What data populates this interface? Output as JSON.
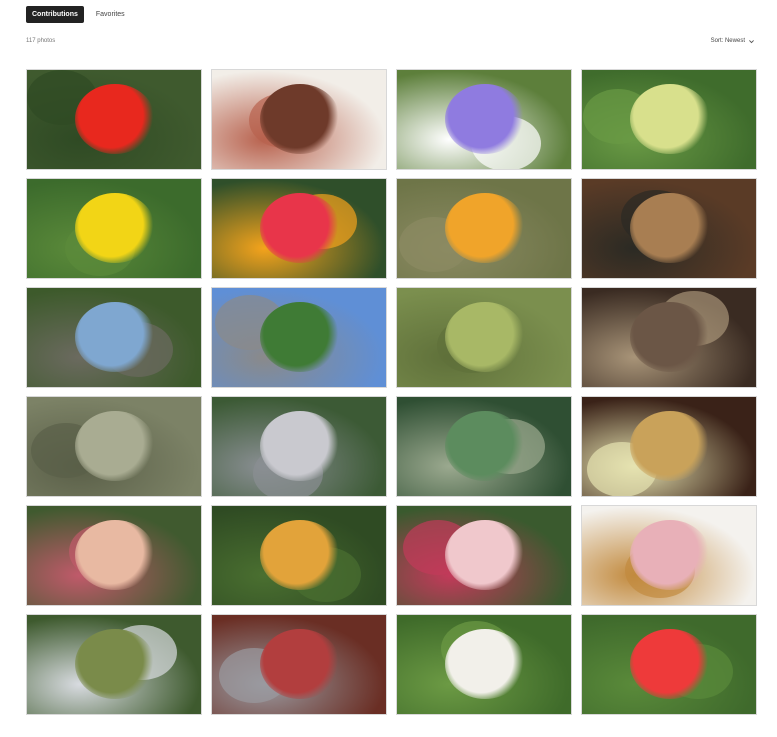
{
  "tabs": [
    {
      "label": "Contributions",
      "active": true
    },
    {
      "label": "Favorites",
      "active": false
    }
  ],
  "photo_count": "117 photos",
  "sort_label": "Sort: Newest",
  "photos": [
    {
      "icon": "red-geranium-photo",
      "bg": "#3f5a2e",
      "accent": "#e8281e",
      "accent2": "#2f4a24"
    },
    {
      "icon": "steak-plate-photo",
      "bg": "#f2eee8",
      "accent": "#6e3a2a",
      "accent2": "#b8624e"
    },
    {
      "icon": "purple-morning-glory-photo",
      "bg": "#5d7f3b",
      "accent": "#8f7be0",
      "accent2": "#ffffff"
    },
    {
      "icon": "green-fruit-leaves-photo",
      "bg": "#3f6c2c",
      "accent": "#d8e08c",
      "accent2": "#6a9a45"
    },
    {
      "icon": "yellow-daisy-photo",
      "bg": "#3c6b2c",
      "accent": "#f2d516",
      "accent2": "#5b8a3a"
    },
    {
      "icon": "lantana-flowers-photo",
      "bg": "#2f4f2a",
      "accent": "#e8354a",
      "accent2": "#f4a31c"
    },
    {
      "icon": "dry-orange-flower-photo",
      "bg": "#6e7548",
      "accent": "#f0a42a",
      "accent2": "#8b8a62"
    },
    {
      "icon": "wooden-pergola-photo",
      "bg": "#5a3b26",
      "accent": "#a87e52",
      "accent2": "#2b2a24"
    },
    {
      "icon": "overgrown-courtyard-photo",
      "bg": "#3d5a2b",
      "accent": "#7fa7d0",
      "accent2": "#6b6a5f"
    },
    {
      "icon": "gazebo-park-photo",
      "bg": "#5f8fd6",
      "accent": "#3f7b35",
      "accent2": "#8a8a8a"
    },
    {
      "icon": "green-bananas-photo",
      "bg": "#7b8f4e",
      "accent": "#a8b866",
      "accent2": "#5f703a"
    },
    {
      "icon": "wooden-bench-photo",
      "bg": "#3a2b22",
      "accent": "#6b5646",
      "accent2": "#a89478"
    },
    {
      "icon": "ornamental-grass-photo",
      "bg": "#7c8266",
      "accent": "#a9ac92",
      "accent2": "#5a5f48"
    },
    {
      "icon": "silver-rubber-leaves-photo",
      "bg": "#3c5a35",
      "accent": "#c9c9cf",
      "accent2": "#8a8f93"
    },
    {
      "icon": "agave-plant-photo",
      "bg": "#2f4f33",
      "accent": "#5c8c5e",
      "accent2": "#9ba98f"
    },
    {
      "icon": "chocolate-cake-photo",
      "bg": "#3a2218",
      "accent": "#c9a25a",
      "accent2": "#e6e3b0"
    },
    {
      "icon": "fig-fruit-photo",
      "bg": "#405a2f",
      "accent": "#e8b9a2",
      "accent2": "#c05a6a"
    },
    {
      "icon": "yellow-blossom-tree-photo",
      "bg": "#2f4b23",
      "accent": "#e2a33a",
      "accent2": "#4a6f30"
    },
    {
      "icon": "pink-hibiscus-photo",
      "bg": "#3a5a2e",
      "accent": "#f0c8cc",
      "accent2": "#c23a5a"
    },
    {
      "icon": "snoopy-cake-photo",
      "bg": "#f4f2ee",
      "accent": "#e8b0b8",
      "accent2": "#c28a3e"
    },
    {
      "icon": "papaya-tree-photo",
      "bg": "#3e5a2e",
      "accent": "#7a8b4a",
      "accent2": "#d8dbe0"
    },
    {
      "icon": "red-autumn-leaves-photo",
      "bg": "#6a2e24",
      "accent": "#b23e3e",
      "accent2": "#9a9aa0"
    },
    {
      "icon": "dandelion-seedhead-photo",
      "bg": "#3f6b2a",
      "accent": "#f2f0ea",
      "accent2": "#6c9a44"
    },
    {
      "icon": "red-geranium-garden-photo",
      "bg": "#3f6a2c",
      "accent": "#ee3a3a",
      "accent2": "#5a8a3a"
    }
  ]
}
